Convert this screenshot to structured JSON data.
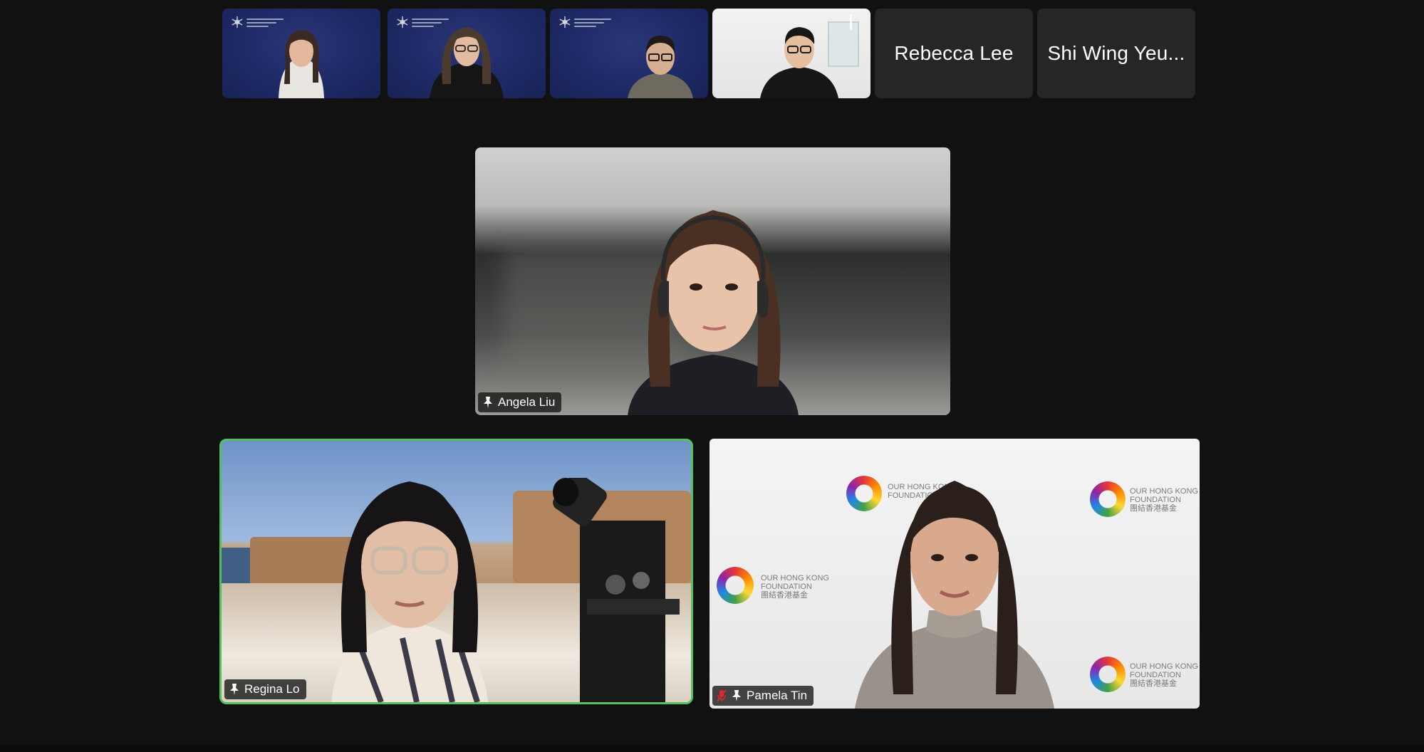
{
  "meeting": {
    "thumbnails": [
      {
        "id": "thumb-1",
        "name": "",
        "video": true,
        "background": "navy"
      },
      {
        "id": "thumb-2",
        "name": "",
        "video": true,
        "background": "navy"
      },
      {
        "id": "thumb-3",
        "name": "",
        "video": true,
        "background": "navy"
      },
      {
        "id": "thumb-4",
        "name": "",
        "video": true,
        "background": "white"
      },
      {
        "id": "thumb-5",
        "name": "Rebecca Lee",
        "video": false
      },
      {
        "id": "thumb-6",
        "name": "Shi Wing Yeu...",
        "video": false
      }
    ],
    "main_tiles": {
      "top": {
        "name": "Angela Liu",
        "pinned": true,
        "muted": false
      },
      "bottom_left": {
        "name": "Regina Lo",
        "pinned": true,
        "muted": false,
        "active_speaker": true
      },
      "bottom_right": {
        "name": "Pamela Tin",
        "pinned": true,
        "muted": true
      }
    },
    "backdrop_text": {
      "line1": "OUR HONG KONG",
      "line2": "FOUNDATION",
      "line3": "團結香港基金"
    }
  },
  "colors": {
    "background": "#111111",
    "active_speaker_border": "#54c060",
    "name_tag_background": "rgba(20,20,20,0.78)",
    "muted_icon": "#e02828"
  },
  "icons": {
    "pin": "pin-icon",
    "mic_muted": "mic-muted-icon",
    "logo": "snowflake-logo-icon"
  }
}
